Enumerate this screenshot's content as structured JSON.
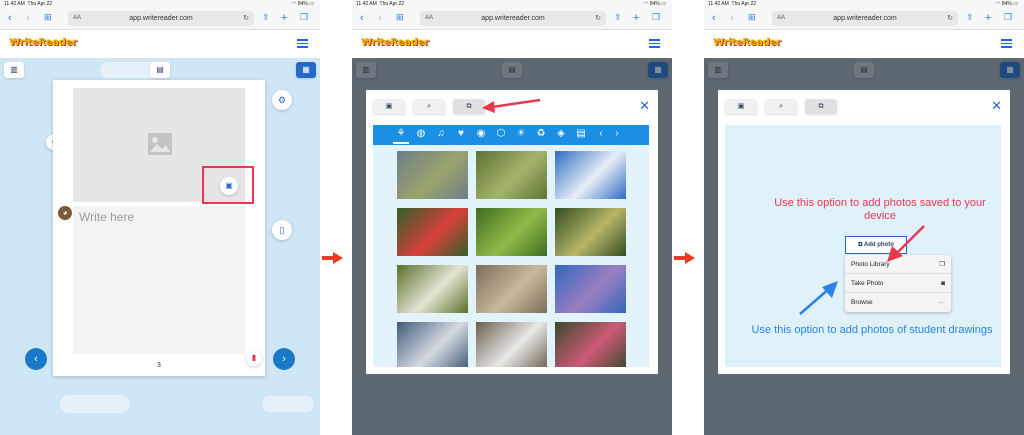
{
  "status": {
    "time": "11:42 AM",
    "date": "Thu Apr 22",
    "battery": "84%"
  },
  "browser": {
    "aa": "AA",
    "url": "app.writereader.com"
  },
  "app": {
    "logo": "WriteReader"
  },
  "editor": {
    "placeholder": "Write here",
    "page_number": "3"
  },
  "photo_modal": {
    "tabs": [
      {
        "icon": "gallery-icon",
        "active": false
      },
      {
        "icon": "search-icon",
        "active": false
      },
      {
        "icon": "add-photo-icon",
        "active": true
      }
    ],
    "categories": [
      "plant-icon",
      "globe-icon",
      "music-icon",
      "heart-icon",
      "food-icon",
      "box-icon",
      "sun-icon",
      "recycle-icon",
      "shapes-icon",
      "id-card-icon"
    ],
    "photos": [
      {
        "colors": [
          "#6d7e8a",
          "#9aa36b"
        ]
      },
      {
        "colors": [
          "#5d7434",
          "#a3b36a"
        ]
      },
      {
        "colors": [
          "#2d6cc2",
          "#e8eef6"
        ]
      },
      {
        "colors": [
          "#2f5f2b",
          "#d9403a"
        ]
      },
      {
        "colors": [
          "#3e6d1f",
          "#92b94a"
        ]
      },
      {
        "colors": [
          "#324e22",
          "#b8b56a"
        ]
      },
      {
        "colors": [
          "#59702b",
          "#e4e4d2"
        ]
      },
      {
        "colors": [
          "#7a6d5a",
          "#c9b99a"
        ]
      },
      {
        "colors": [
          "#3367b8",
          "#9b7fc3"
        ]
      },
      {
        "colors": [
          "#3e5a78",
          "#d6dbe2"
        ]
      },
      {
        "colors": [
          "#6c5f4d",
          "#e8e8e8"
        ]
      },
      {
        "colors": [
          "#3a4a2a",
          "#cc5a77"
        ]
      }
    ]
  },
  "upload": {
    "add_photo_label": "Add photo",
    "menu": [
      {
        "label": "Photo Library",
        "icon": "photo-library-icon"
      },
      {
        "label": "Take Photo",
        "icon": "camera-icon"
      },
      {
        "label": "Browse",
        "icon": "more-icon"
      }
    ],
    "note_device": "Use this option to add photos saved to your device",
    "note_drawings": "Use this option to add photos of student drawings"
  },
  "colors": {
    "accent": "#2469c7",
    "category_bar": "#1a8fe3",
    "annotation_red": "#e8384f",
    "annotation_blue": "#2b83e6",
    "flow_arrow": "#ef3b24"
  }
}
